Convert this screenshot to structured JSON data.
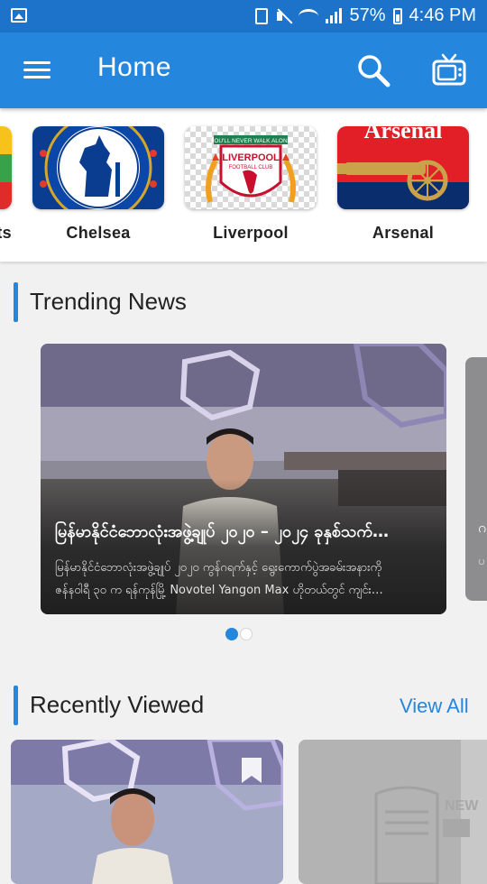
{
  "status_bar": {
    "battery": "57%",
    "time": "4:46 PM"
  },
  "app_bar": {
    "title": "Home",
    "bg_color": "#2586dd",
    "icons": [
      "menu-icon",
      "search-icon",
      "tv-icon"
    ]
  },
  "teams": [
    {
      "label": "ts",
      "logo": "myanmar-flag-logo"
    },
    {
      "label": "Chelsea",
      "logo": "chelsea-crest"
    },
    {
      "label": "Liverpool",
      "logo": "liverpool-crest",
      "logo_text": [
        "YOU'LL NEVER WALK ALONE",
        "LIVERPOOL",
        "FOOTBALL CLUB"
      ]
    },
    {
      "label": "Arsenal",
      "logo": "arsenal-crest",
      "logo_text": "Arsenal"
    }
  ],
  "trending": {
    "heading": "Trending News",
    "card": {
      "title": "မြန်မာနိုင်ငံဘောလုံးအဖွဲ့ချုပ် ၂၀၂၀ – ၂၀၂၄ ခုနှစ်သက်…",
      "desc_line1": "မြန်မာနိုင်ငံဘောလုံးအဖွဲ့ချုပ် ၂၀၂၀ ကွန်ဂရက်နှင့် ရွေးကောက်ပွဲအခမ်းအနားကို",
      "desc_line2": "ဇန်နဝါရီ ၃၀ က ရန်ကုန်မြို့ Novotel Yangon Max ဟိုတယ်တွင် ကျင်း…"
    },
    "peek_card": {
      "title_fragment": "ဂ",
      "desc_fragment": "ပ"
    },
    "pager": {
      "count": 2,
      "active_index": 0
    }
  },
  "recent": {
    "heading": "Recently Viewed",
    "view_all": "View All",
    "cards": [
      {
        "type": "photo"
      },
      {
        "type": "placeholder-newspaper",
        "placeholder_text": "NEW"
      }
    ]
  }
}
